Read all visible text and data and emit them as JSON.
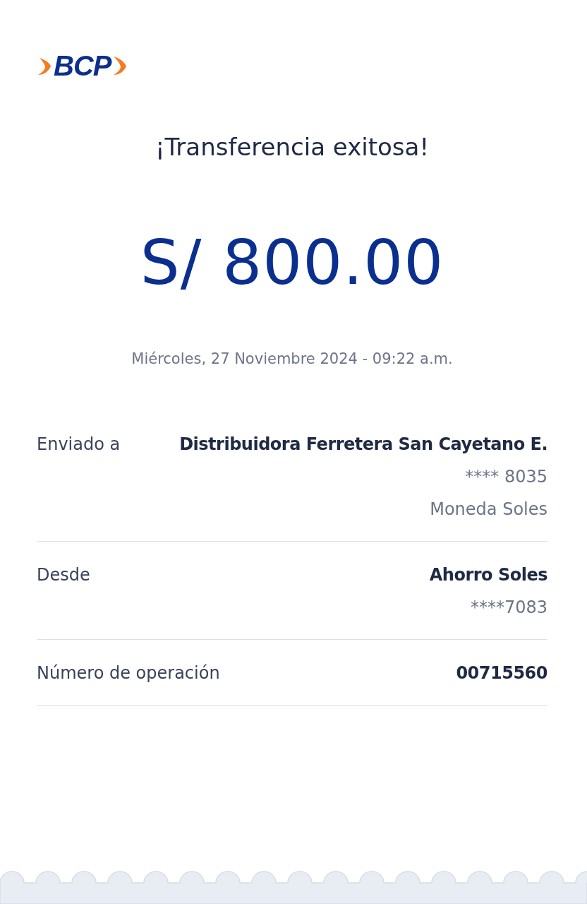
{
  "logo": {
    "text": "BCP"
  },
  "title": "¡Transferencia exitosa!",
  "amount": "S/ 800.00",
  "date": "Miércoles, 27 Noviembre 2024 - 09:22 a.m.",
  "details": [
    {
      "label": "Enviado a",
      "lines": [
        {
          "text": "Distribuidora Ferretera San Cayetano E.",
          "strong": true
        },
        {
          "text": "**** 8035",
          "strong": false
        },
        {
          "text": "Moneda Soles",
          "strong": false
        }
      ]
    },
    {
      "label": "Desde",
      "lines": [
        {
          "text": "Ahorro Soles",
          "strong": true
        },
        {
          "text": "****7083",
          "strong": false
        }
      ]
    },
    {
      "label": "Número de operación",
      "lines": [
        {
          "text": "00715560",
          "strong": true
        }
      ]
    }
  ]
}
